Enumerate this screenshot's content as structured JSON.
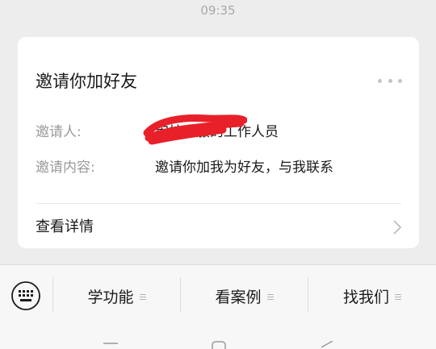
{
  "status": {
    "time": "09:35"
  },
  "card": {
    "title": "邀请你加好友",
    "inviter_label": "邀请人:",
    "inviter_value": "审核客服的工作人员",
    "content_label": "邀请内容:",
    "content_value": "邀请你加我为好友，与我联系",
    "details_label": "查看详情"
  },
  "menu": {
    "items": [
      {
        "label": "学功能"
      },
      {
        "label": "看案例"
      },
      {
        "label": "找我们"
      }
    ]
  },
  "colors": {
    "redaction": "#e8202a",
    "background": "#ededed",
    "card": "#ffffff"
  },
  "icons": [
    "more-icon",
    "chevron-right-icon",
    "keyboard-icon",
    "menu-icon",
    "nav-menu-icon",
    "nav-home-icon",
    "nav-back-icon"
  ]
}
